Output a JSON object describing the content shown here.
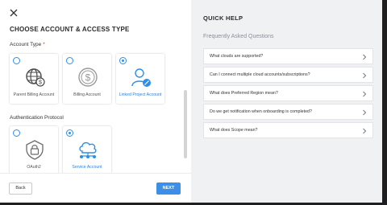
{
  "left": {
    "title": "CHOOSE ACCOUNT & ACCESS TYPE",
    "account_type": {
      "label": "Account Type",
      "required": "*",
      "options": [
        {
          "label": "Parent Billing Account",
          "selected": false,
          "icon": "globe-dollar-icon"
        },
        {
          "label": "Billing Account",
          "selected": false,
          "icon": "dollar-coin-icon"
        },
        {
          "label": "Linked Project Account",
          "selected": true,
          "icon": "user-link-icon"
        }
      ]
    },
    "auth_protocol": {
      "label": "Authentication Protocol",
      "required": "*",
      "options": [
        {
          "label": "OAuth2",
          "selected": false,
          "icon": "lock-icon"
        },
        {
          "label": "Service Account",
          "selected": true,
          "icon": "cloud-network-icon"
        }
      ]
    },
    "back_label": "Back",
    "next_label": "NEXT"
  },
  "right": {
    "title": "QUICK HELP",
    "faq_title": "Frequently Asked Questions",
    "questions": [
      "What clouds are supported?",
      "Can I connect multiple cloud accounts/subscriptions?",
      "What does Preferred Region mean?",
      "Do we get notification when onboarding is completed?",
      "What does Scope mean?"
    ]
  },
  "colors": {
    "accent": "#2f8fe6",
    "next_button": "#3b8fe8",
    "required": "#e0322c",
    "help_bg": "#f0f1f3"
  }
}
